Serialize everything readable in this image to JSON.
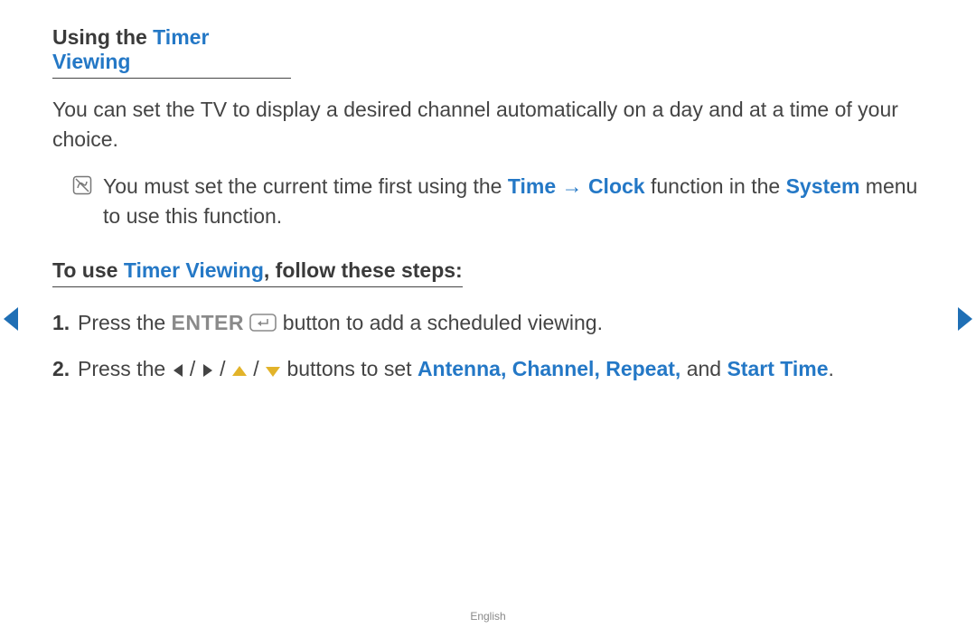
{
  "heading": {
    "prefix": "Using the ",
    "accent": "Timer Viewing"
  },
  "intro": "You can set the TV to display a desired channel automatically on a day and at a time of your choice.",
  "note": {
    "part1": "You must set the current time first using the ",
    "time": "Time",
    "arrow": " → ",
    "clock": "Clock",
    "part2": " function in the ",
    "system": "System",
    "part3": " menu to use this function."
  },
  "subheading": {
    "prefix": "To use ",
    "accent": "Timer Viewing",
    "suffix": ", follow these steps:"
  },
  "steps": [
    {
      "num": "1.",
      "p1": "Press the ",
      "enter": "ENTER",
      "p2": " button to add a scheduled viewing."
    },
    {
      "num": "2.",
      "p1": "Press the ",
      "sep": " / ",
      "p2": " buttons to set ",
      "a1": "Antenna, Channel, Repeat,",
      "and": " and ",
      "a2": "Start Time",
      "period": "."
    }
  ],
  "footer": "English",
  "colors": {
    "accent": "#2478c6",
    "navArrow": "#1f6fb5",
    "triangle": "#e2b32a"
  }
}
